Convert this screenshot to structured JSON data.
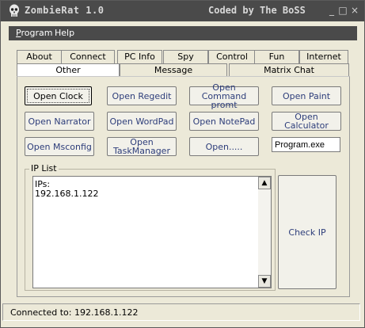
{
  "window": {
    "title": "ZombieRat 1.0",
    "subtitle": "Coded by The BoSS",
    "controls": [
      "_",
      "□",
      "×"
    ]
  },
  "menu": {
    "program": "Program",
    "help": "Help"
  },
  "tabs_top": [
    "About",
    "Connect",
    "PC Info",
    "Spy",
    "Control",
    "Fun",
    "Internet"
  ],
  "tabs_bottom": [
    "Other",
    "Message",
    "Matrix Chat"
  ],
  "selected_tab": "Other",
  "buttons": {
    "open_clock": "Open Clock",
    "open_regedit": "Open Regedit",
    "open_command_l1": "Open Command",
    "open_command_l2": "promt",
    "open_paint": "Open Paint",
    "open_narrator": "Open Narrator",
    "open_wordpad": "Open WordPad",
    "open_notepad": "Open NotePad",
    "open_calculator": "Open Calculator",
    "open_msconfig": "Open Msconfig",
    "open_taskmanager_l1": "Open",
    "open_taskmanager_l2": "TaskManager",
    "open_dots": "Open.....",
    "check_ip": "Check IP"
  },
  "program_input": {
    "value": "Program.exe"
  },
  "ip_list": {
    "label": "IP List",
    "lines": [
      "IPs:",
      "192.168.1.122"
    ]
  },
  "status": {
    "text": "Connected to: 192.168.1.122"
  },
  "icons": {
    "app": "skull-icon",
    "scroll_up": "▲",
    "scroll_down": "▼"
  }
}
